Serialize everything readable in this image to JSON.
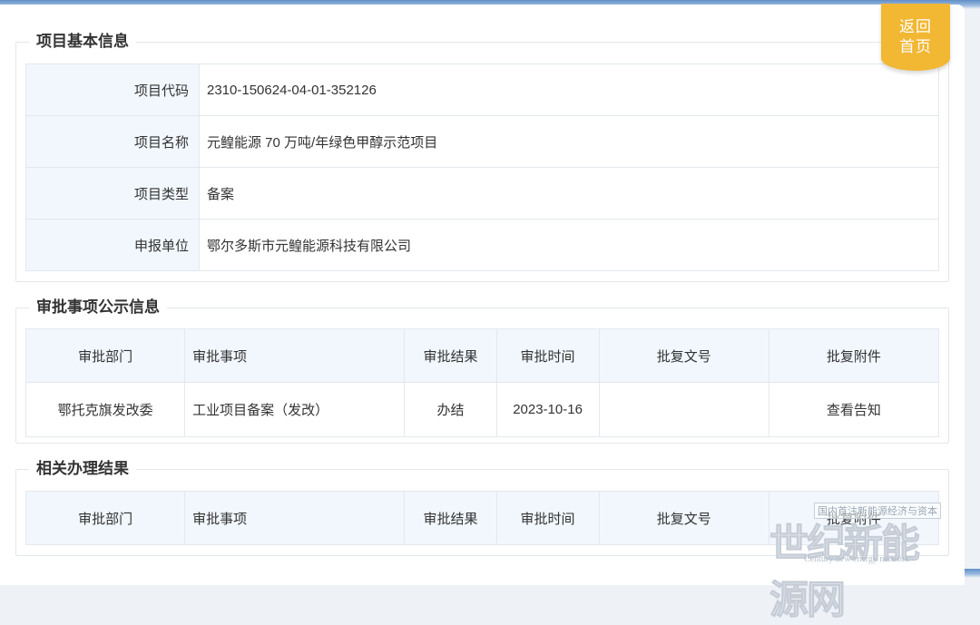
{
  "return_button": {
    "line1": "返回",
    "line2": "首页"
  },
  "basic_info": {
    "legend": "项目基本信息",
    "rows": [
      {
        "label": "项目代码",
        "value": "2310-150624-04-01-352126"
      },
      {
        "label": "项目名称",
        "value": "元鳇能源 70 万吨/年绿色甲醇示范项目"
      },
      {
        "label": "项目类型",
        "value": "备案"
      },
      {
        "label": "申报单位",
        "value": "鄂尔多斯市元鳇能源科技有限公司"
      }
    ]
  },
  "approval_info": {
    "legend": "审批事项公示信息",
    "headers": [
      "审批部门",
      "审批事项",
      "审批结果",
      "审批时间",
      "批复文号",
      "批复附件"
    ],
    "rows": [
      {
        "dept": "鄂托克旗发改委",
        "item": "工业项目备案（发改）",
        "result": "办结",
        "time": "2023-10-16",
        "doc_no": "",
        "attachment": "查看告知"
      }
    ]
  },
  "related_results": {
    "legend": "相关办理结果",
    "headers": [
      "审批部门",
      "审批事项",
      "审批结果",
      "审批时间",
      "批复文号",
      "批复附件"
    ]
  },
  "watermark": {
    "banner": "国内首注新能源经济与资本",
    "title": "世纪新能源网",
    "subtitle": "Century new energy network"
  }
}
